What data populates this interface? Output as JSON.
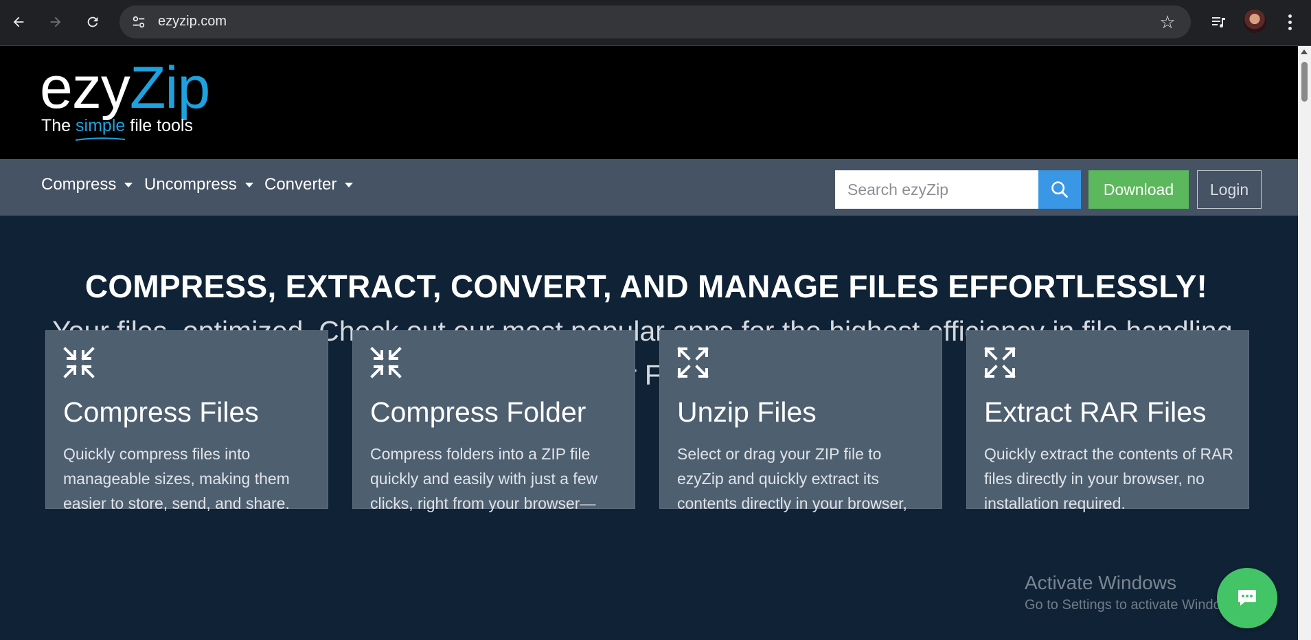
{
  "browser": {
    "url": "ezyzip.com",
    "icons": {
      "back": "back-arrow-icon",
      "forward": "forward-arrow-icon",
      "reload": "reload-icon",
      "site_info": "tune-icon",
      "bookmark": "star-icon",
      "media": "media-control-icon",
      "menu": "kebab-menu-icon"
    }
  },
  "header": {
    "logo_ezy": "ezy",
    "logo_zip": "Zip",
    "tagline_the": "The",
    "tagline_simple": "simple",
    "tagline_rest": "file tools",
    "accent_color": "#1ea2df"
  },
  "nav": {
    "menus": [
      "Compress",
      "Uncompress",
      "Converter"
    ],
    "search_placeholder": "Search ezyZip",
    "download_label": "Download",
    "login_label": "Login",
    "colors": {
      "search": "#3a97e6",
      "download": "#5cb85c"
    }
  },
  "hero": {
    "title": "COMPRESS, EXTRACT, CONVERT, AND MANAGE FILES EFFORTLESSLY!",
    "subtitle_line1": "Your files, optimized. Check out our most popular apps for the highest efficiency in file handling.",
    "subtitle_line2": "All for FREE!"
  },
  "cards": [
    {
      "icon": "compress-arrows-icon",
      "title": "Compress Files",
      "desc": "Quickly compress files into manageable sizes, making them easier to store, send, and share."
    },
    {
      "icon": "compress-arrows-icon",
      "title": "Compress Folder",
      "desc": "Compress folders into a ZIP file quickly and easily with just a few clicks, right from your browser—"
    },
    {
      "icon": "expand-arrows-icon",
      "title": "Unzip Files",
      "desc": "Select or drag your ZIP file to ezyZip and quickly extract its contents directly in your browser,"
    },
    {
      "icon": "expand-arrows-icon",
      "title": "Extract RAR Files",
      "desc": "Quickly extract the contents of RAR files directly in your browser, no installation required."
    }
  ],
  "overlay": {
    "watermark_line1": "Activate Windows",
    "watermark_line2": "Go to Settings to activate Windows.",
    "chat_icon": "chat-bubble-icon"
  }
}
